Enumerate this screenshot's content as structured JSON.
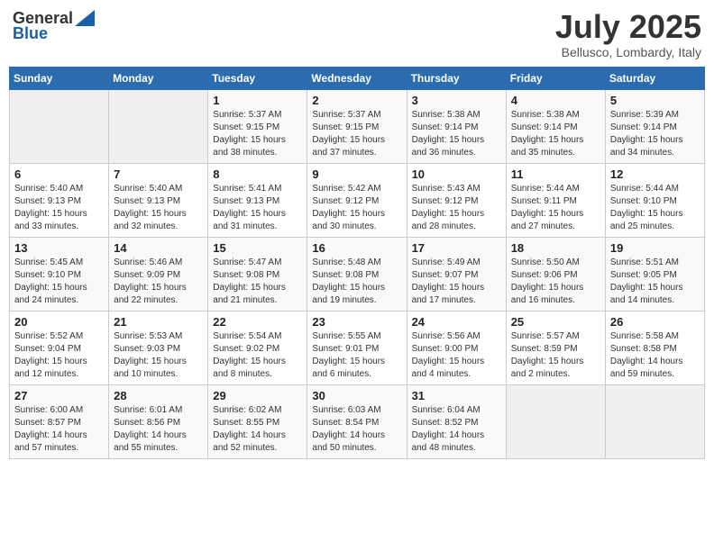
{
  "header": {
    "logo_general": "General",
    "logo_blue": "Blue",
    "month_year": "July 2025",
    "location": "Bellusco, Lombardy, Italy"
  },
  "columns": [
    "Sunday",
    "Monday",
    "Tuesday",
    "Wednesday",
    "Thursday",
    "Friday",
    "Saturday"
  ],
  "weeks": [
    [
      {
        "day": "",
        "info": ""
      },
      {
        "day": "",
        "info": ""
      },
      {
        "day": "1",
        "info": "Sunrise: 5:37 AM\nSunset: 9:15 PM\nDaylight: 15 hours and 38 minutes."
      },
      {
        "day": "2",
        "info": "Sunrise: 5:37 AM\nSunset: 9:15 PM\nDaylight: 15 hours and 37 minutes."
      },
      {
        "day": "3",
        "info": "Sunrise: 5:38 AM\nSunset: 9:14 PM\nDaylight: 15 hours and 36 minutes."
      },
      {
        "day": "4",
        "info": "Sunrise: 5:38 AM\nSunset: 9:14 PM\nDaylight: 15 hours and 35 minutes."
      },
      {
        "day": "5",
        "info": "Sunrise: 5:39 AM\nSunset: 9:14 PM\nDaylight: 15 hours and 34 minutes."
      }
    ],
    [
      {
        "day": "6",
        "info": "Sunrise: 5:40 AM\nSunset: 9:13 PM\nDaylight: 15 hours and 33 minutes."
      },
      {
        "day": "7",
        "info": "Sunrise: 5:40 AM\nSunset: 9:13 PM\nDaylight: 15 hours and 32 minutes."
      },
      {
        "day": "8",
        "info": "Sunrise: 5:41 AM\nSunset: 9:13 PM\nDaylight: 15 hours and 31 minutes."
      },
      {
        "day": "9",
        "info": "Sunrise: 5:42 AM\nSunset: 9:12 PM\nDaylight: 15 hours and 30 minutes."
      },
      {
        "day": "10",
        "info": "Sunrise: 5:43 AM\nSunset: 9:12 PM\nDaylight: 15 hours and 28 minutes."
      },
      {
        "day": "11",
        "info": "Sunrise: 5:44 AM\nSunset: 9:11 PM\nDaylight: 15 hours and 27 minutes."
      },
      {
        "day": "12",
        "info": "Sunrise: 5:44 AM\nSunset: 9:10 PM\nDaylight: 15 hours and 25 minutes."
      }
    ],
    [
      {
        "day": "13",
        "info": "Sunrise: 5:45 AM\nSunset: 9:10 PM\nDaylight: 15 hours and 24 minutes."
      },
      {
        "day": "14",
        "info": "Sunrise: 5:46 AM\nSunset: 9:09 PM\nDaylight: 15 hours and 22 minutes."
      },
      {
        "day": "15",
        "info": "Sunrise: 5:47 AM\nSunset: 9:08 PM\nDaylight: 15 hours and 21 minutes."
      },
      {
        "day": "16",
        "info": "Sunrise: 5:48 AM\nSunset: 9:08 PM\nDaylight: 15 hours and 19 minutes."
      },
      {
        "day": "17",
        "info": "Sunrise: 5:49 AM\nSunset: 9:07 PM\nDaylight: 15 hours and 17 minutes."
      },
      {
        "day": "18",
        "info": "Sunrise: 5:50 AM\nSunset: 9:06 PM\nDaylight: 15 hours and 16 minutes."
      },
      {
        "day": "19",
        "info": "Sunrise: 5:51 AM\nSunset: 9:05 PM\nDaylight: 15 hours and 14 minutes."
      }
    ],
    [
      {
        "day": "20",
        "info": "Sunrise: 5:52 AM\nSunset: 9:04 PM\nDaylight: 15 hours and 12 minutes."
      },
      {
        "day": "21",
        "info": "Sunrise: 5:53 AM\nSunset: 9:03 PM\nDaylight: 15 hours and 10 minutes."
      },
      {
        "day": "22",
        "info": "Sunrise: 5:54 AM\nSunset: 9:02 PM\nDaylight: 15 hours and 8 minutes."
      },
      {
        "day": "23",
        "info": "Sunrise: 5:55 AM\nSunset: 9:01 PM\nDaylight: 15 hours and 6 minutes."
      },
      {
        "day": "24",
        "info": "Sunrise: 5:56 AM\nSunset: 9:00 PM\nDaylight: 15 hours and 4 minutes."
      },
      {
        "day": "25",
        "info": "Sunrise: 5:57 AM\nSunset: 8:59 PM\nDaylight: 15 hours and 2 minutes."
      },
      {
        "day": "26",
        "info": "Sunrise: 5:58 AM\nSunset: 8:58 PM\nDaylight: 14 hours and 59 minutes."
      }
    ],
    [
      {
        "day": "27",
        "info": "Sunrise: 6:00 AM\nSunset: 8:57 PM\nDaylight: 14 hours and 57 minutes."
      },
      {
        "day": "28",
        "info": "Sunrise: 6:01 AM\nSunset: 8:56 PM\nDaylight: 14 hours and 55 minutes."
      },
      {
        "day": "29",
        "info": "Sunrise: 6:02 AM\nSunset: 8:55 PM\nDaylight: 14 hours and 52 minutes."
      },
      {
        "day": "30",
        "info": "Sunrise: 6:03 AM\nSunset: 8:54 PM\nDaylight: 14 hours and 50 minutes."
      },
      {
        "day": "31",
        "info": "Sunrise: 6:04 AM\nSunset: 8:52 PM\nDaylight: 14 hours and 48 minutes."
      },
      {
        "day": "",
        "info": ""
      },
      {
        "day": "",
        "info": ""
      }
    ]
  ]
}
